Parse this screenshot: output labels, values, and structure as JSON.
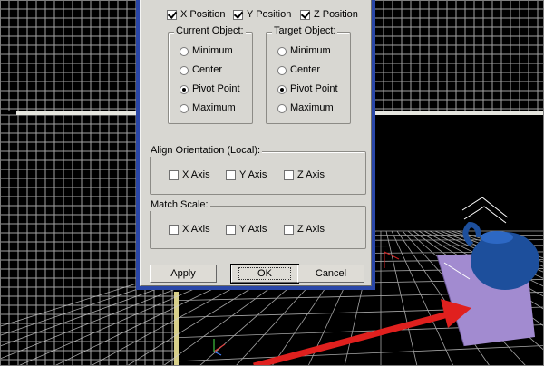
{
  "position_axes": [
    {
      "label": "X Position",
      "checked": true
    },
    {
      "label": "Y Position",
      "checked": true
    },
    {
      "label": "Z Position",
      "checked": true
    }
  ],
  "current_object": {
    "title": "Current Object:",
    "options": [
      "Minimum",
      "Center",
      "Pivot Point",
      "Maximum"
    ],
    "selected": "Pivot Point"
  },
  "target_object": {
    "title": "Target Object:",
    "options": [
      "Minimum",
      "Center",
      "Pivot Point",
      "Maximum"
    ],
    "selected": "Pivot Point"
  },
  "align_orientation": {
    "title": "Align Orientation (Local):",
    "axes": [
      "X Axis",
      "Y Axis",
      "Z Axis"
    ]
  },
  "match_scale": {
    "title": "Match Scale:",
    "axes": [
      "X Axis",
      "Y Axis",
      "Z Axis"
    ]
  },
  "buttons": {
    "apply": "Apply",
    "ok": "OK",
    "cancel": "Cancel"
  },
  "colors": {
    "viewport_bg": "#000000",
    "grid_line": "#c8c8c8",
    "viewport_border_active": "#e8e0a0",
    "teapot": "#1d4f9c",
    "plane": "#a28bd0",
    "arrow": "#e0201e",
    "dialog_frame": "#2a47a8",
    "dialog_face": "#d8d7d2"
  },
  "icons": [
    "viewport-axis-tripod-icon",
    "annotation-arrow-icon",
    "teapot-object",
    "plane-object"
  ]
}
